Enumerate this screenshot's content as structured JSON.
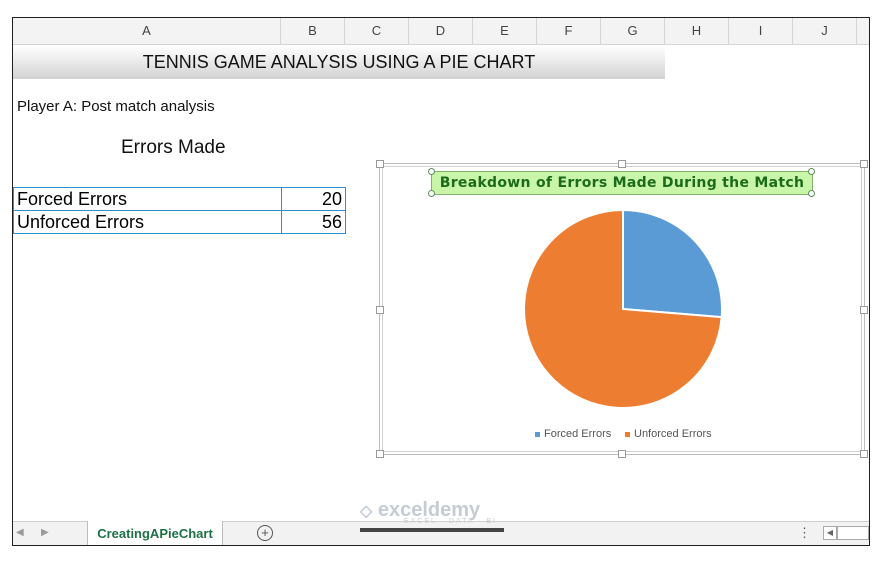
{
  "columns": [
    "A",
    "B",
    "C",
    "D",
    "E",
    "F",
    "G",
    "H",
    "I",
    "J"
  ],
  "banner": "TENNIS GAME ANALYSIS USING A PIE CHART",
  "subtitle": "Player A: Post match analysis",
  "table_title": "Errors Made",
  "rows": [
    {
      "label": "Forced Errors",
      "value": "20"
    },
    {
      "label": "Unforced Errors",
      "value": "56"
    }
  ],
  "chart_data": {
    "type": "pie",
    "title": "Breakdown of Errors Made During the Match",
    "categories": [
      "Forced Errors",
      "Unforced Errors"
    ],
    "values": [
      20,
      56
    ],
    "colors": [
      "#5b9bd5",
      "#ed7d31"
    ],
    "legend": "bottom"
  },
  "sheet_tab": "CreatingAPieChart",
  "watermark": {
    "brand": "exceldemy",
    "tagline": "EXCEL · DATA · BI"
  },
  "icons": {
    "add_sheet": "plus-circle-icon",
    "prev": "triangle-left-icon",
    "next": "triangle-right-icon",
    "more": "vertical-ellipsis-icon"
  }
}
